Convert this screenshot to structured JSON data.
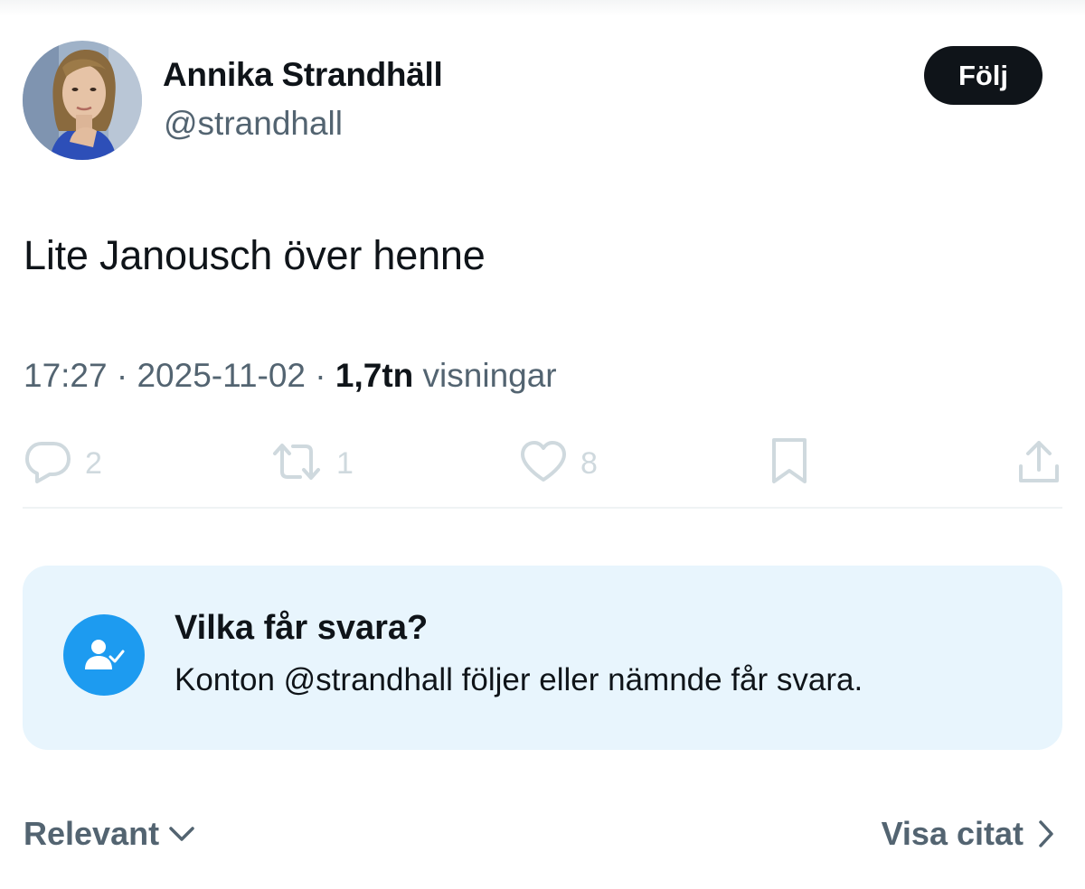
{
  "author": {
    "display_name": "Annika Strandhäll",
    "handle": "@strandhall"
  },
  "follow_button": {
    "label": "Följ"
  },
  "tweet": {
    "text": "Lite Janousch över henne",
    "time": "17:27",
    "separator": " · ",
    "date": "2025-11-02",
    "views_count": "1,7tn",
    "views_label": " visningar"
  },
  "actions": {
    "replies": {
      "icon": "reply-icon",
      "count": "2"
    },
    "reposts": {
      "icon": "repost-icon",
      "count": "1"
    },
    "likes": {
      "icon": "heart-icon",
      "count": "8"
    },
    "bookmark": {
      "icon": "bookmark-icon"
    },
    "share": {
      "icon": "share-icon"
    }
  },
  "reply_restriction": {
    "icon": "person-check-icon",
    "title": "Vilka får svara?",
    "description": "Konton @strandhall följer eller nämnde får svara."
  },
  "footer": {
    "sort_label": "Relevant",
    "quotes_label": "Visa citat"
  },
  "colors": {
    "text_primary": "#0f1419",
    "text_secondary": "#536471",
    "action_icon": "#cfd9de",
    "accent": "#1d9bf0",
    "card_background": "#e8f5fd"
  }
}
